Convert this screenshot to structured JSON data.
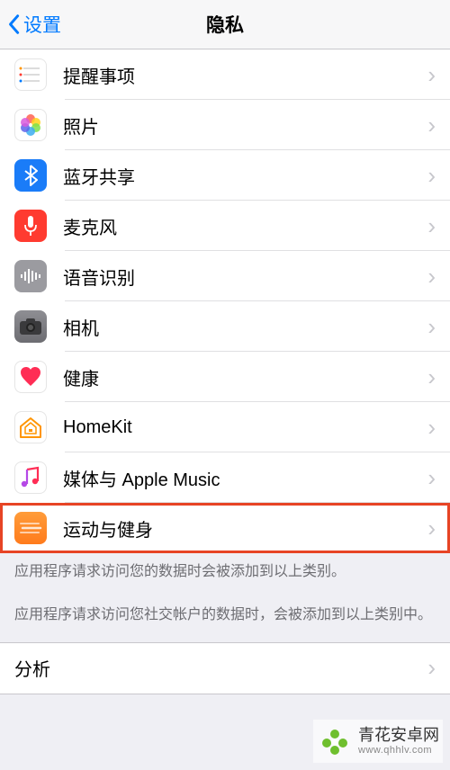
{
  "header": {
    "back_label": "设置",
    "title": "隐私"
  },
  "items": [
    {
      "id": "reminders",
      "label": "提醒事项",
      "icon": "reminders-icon"
    },
    {
      "id": "photos",
      "label": "照片",
      "icon": "photos-icon"
    },
    {
      "id": "bluetooth",
      "label": "蓝牙共享",
      "icon": "bluetooth-icon"
    },
    {
      "id": "microphone",
      "label": "麦克风",
      "icon": "microphone-icon"
    },
    {
      "id": "speech",
      "label": "语音识别",
      "icon": "speech-icon"
    },
    {
      "id": "camera",
      "label": "相机",
      "icon": "camera-icon"
    },
    {
      "id": "health",
      "label": "健康",
      "icon": "health-icon"
    },
    {
      "id": "homekit",
      "label": "HomeKit",
      "icon": "homekit-icon"
    },
    {
      "id": "music",
      "label": "媒体与 Apple Music",
      "icon": "music-icon"
    },
    {
      "id": "motion",
      "label": "运动与健身",
      "icon": "motion-icon",
      "highlighted": true
    }
  ],
  "footer_note_1": "应用程序请求访问您的数据时会被添加到以上类别。",
  "footer_note_2": "应用程序请求访问您社交帐户的数据时，会被添加到以上类别中。",
  "section": {
    "analysis_label": "分析"
  },
  "watermark": {
    "name": "青花安卓网",
    "url": "www.qhhlv.com"
  }
}
